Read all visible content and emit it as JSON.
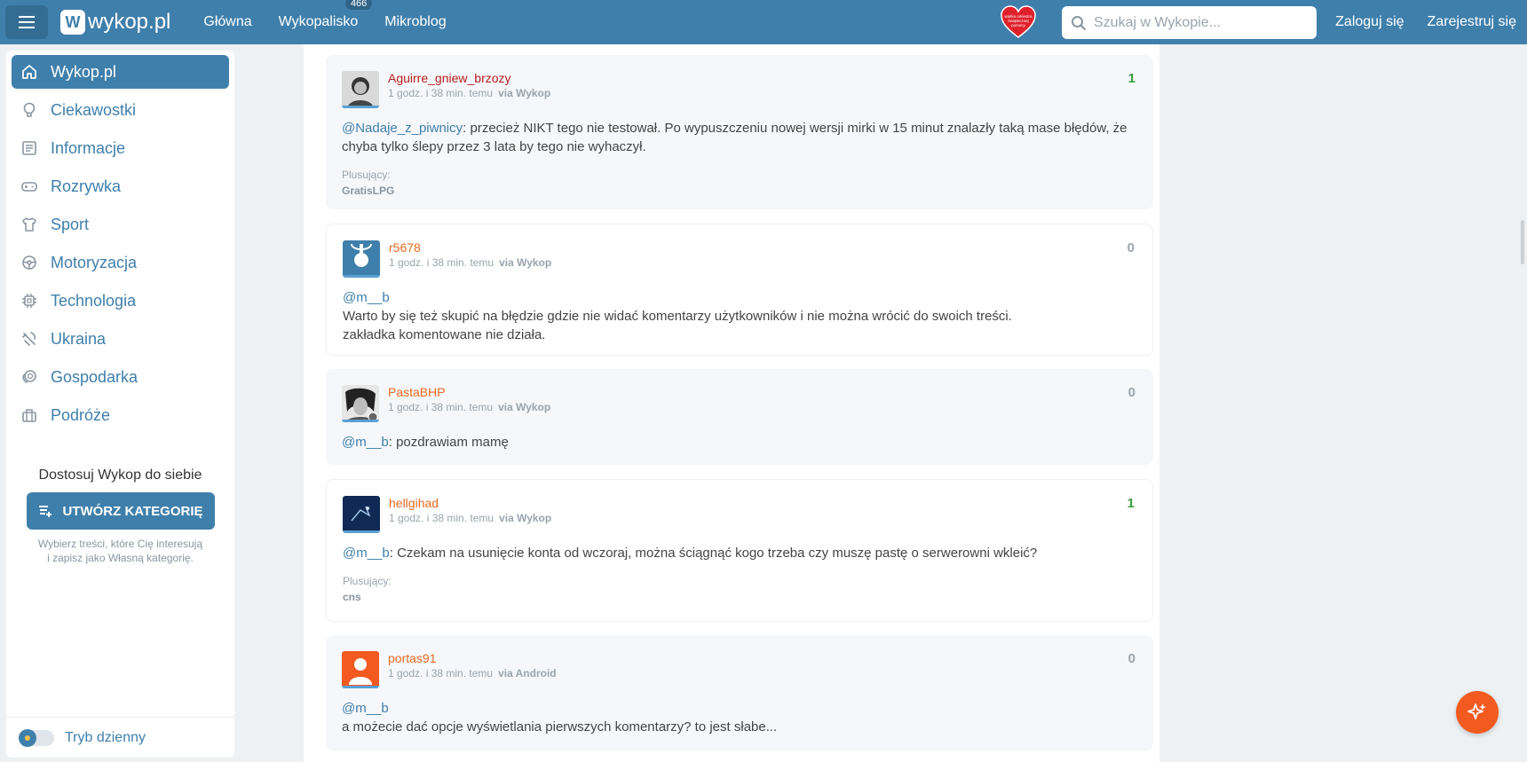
{
  "header": {
    "logo": "wykop.pl",
    "nav": [
      {
        "label": "Główna"
      },
      {
        "label": "Wykopalisko",
        "badge": "466"
      },
      {
        "label": "Mikroblog"
      }
    ],
    "heart_text": "wielka orkiestra świątecznej pomocy",
    "search_placeholder": "Szukaj w Wykopie...",
    "login": "Zaloguj się",
    "register": "Zarejestruj się"
  },
  "sidebar": {
    "items": [
      {
        "label": "Wykop.pl",
        "icon": "home-icon"
      },
      {
        "label": "Ciekawostki",
        "icon": "lightbulb-icon"
      },
      {
        "label": "Informacje",
        "icon": "newspaper-icon"
      },
      {
        "label": "Rozrywka",
        "icon": "gamepad-icon"
      },
      {
        "label": "Sport",
        "icon": "shirt-icon"
      },
      {
        "label": "Motoryzacja",
        "icon": "steering-wheel-icon"
      },
      {
        "label": "Technologia",
        "icon": "chip-icon"
      },
      {
        "label": "Ukraina",
        "icon": "trident-icon"
      },
      {
        "label": "Gospodarka",
        "icon": "coins-icon"
      },
      {
        "label": "Podróże",
        "icon": "luggage-icon"
      }
    ],
    "customize_title": "Dostosuj Wykop do siebie",
    "create_button": "UTWÓRZ KATEGORIĘ",
    "customize_desc_1": "Wybierz treści, które Cię interesują",
    "customize_desc_2": "i zapisz jako Własną kategorię.",
    "theme_label": "Tryb dzienny"
  },
  "comments": [
    {
      "user": "Aguirre_gniew_brzozy",
      "time": "1 godz. i 38 min. temu",
      "via": "via Wykop",
      "score": "1",
      "mention": "@Nadaje_z_piwnicy",
      "text": ": przecież NIKT tego nie testował. Po wypuszczeniu nowej wersji mirki w 15 minut znalazły taką mase błędów, że chyba tylko ślepy przez 3 lata by tego nie wyhaczył.",
      "plus_label": "Plusujący:",
      "plus_names": "GratisLPG"
    },
    {
      "user": "r5678",
      "time": "1 godz. i 38 min. temu",
      "via": "via Wykop",
      "score": "0",
      "mention": "@m__b",
      "line1": "Warto by się też skupić na błędzie gdzie nie widać komentarzy użytkowników i nie można wrócić do swoich treści.",
      "line2": "zakładka komentowane nie działa."
    },
    {
      "user": "PastaBHP",
      "time": "1 godz. i 38 min. temu",
      "via": "via Wykop",
      "score": "0",
      "mention": "@m__b",
      "text": ": pozdrawiam mamę"
    },
    {
      "user": "hellgihad",
      "time": "1 godz. i 38 min. temu",
      "via": "via Wykop",
      "score": "1",
      "mention": "@m__b",
      "text": ": Czekam na usunięcie konta od wczoraj, można ściągnąć kogo trzeba czy muszę pastę o serwerowni wkleić?",
      "plus_label": "Plusujący:",
      "plus_names": "cns"
    },
    {
      "user": "portas91",
      "time": "1 godz. i 38 min. temu",
      "via": "via Android",
      "score": "0",
      "mention": "@m__b",
      "line1": "a możecie dać opcje wyświetlania pierwszych komentarzy? to jest słabe..."
    }
  ],
  "colors": {
    "brand": "#3f7fab",
    "accent": "#f25a20",
    "score_positive": "#3c9d3c"
  }
}
